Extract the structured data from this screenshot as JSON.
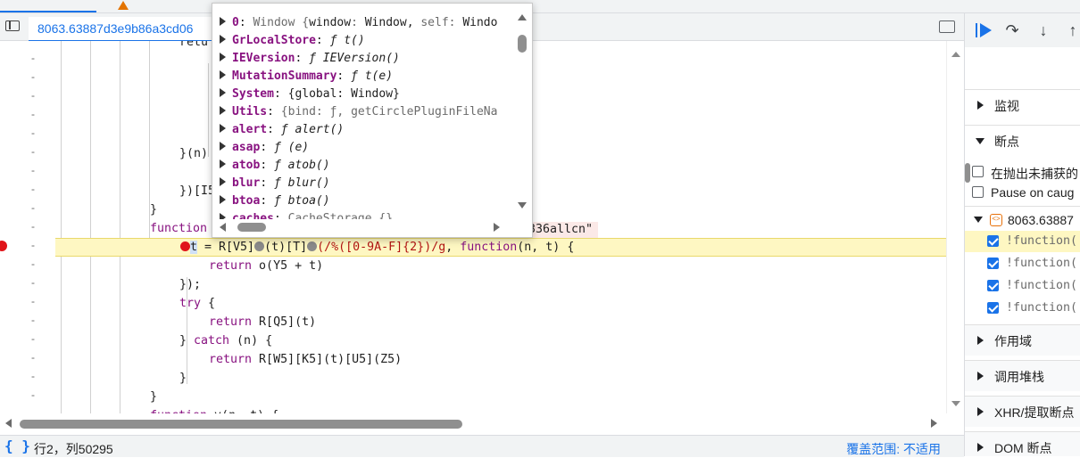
{
  "editor": {
    "file_tab": "8063.63887d3e9b86a3cd06",
    "string_hint": "336allcn\"",
    "lines": [
      {
        "text": "retu"
      },
      {
        "text": "}(n)"
      },
      {
        "text": "})[I5"
      },
      {
        "text": "}"
      },
      {
        "text": "function"
      },
      {
        "text": "return o(Y5 + t)"
      },
      {
        "text": "});"
      },
      {
        "text": "try {"
      },
      {
        "text": "return R[Q5](t)"
      },
      {
        "text": "} catch (n) {"
      },
      {
        "text": "return R[W5][K5](t)[U5](Z5)"
      },
      {
        "text": "}"
      },
      {
        "text": "}"
      },
      {
        "text": "function v(n, t) {"
      }
    ],
    "exec_line": {
      "var": "t",
      "p1": " = R[V5]",
      "p2": "(t)[T]",
      "regex": "(/%([0-9A-F]{2})/g",
      "p3": ", ",
      "kw": "function",
      "p4": "(n, t) {"
    }
  },
  "popover": {
    "rows": [
      {
        "name": "0",
        "value": "Window {window: Window, self: Windo"
      },
      {
        "name": "GrLocalStore",
        "value": "ƒ t()"
      },
      {
        "name": "IEVersion",
        "value": "ƒ IEVersion()"
      },
      {
        "name": "MutationSummary",
        "value": "ƒ t(e)"
      },
      {
        "name": "System",
        "value": "{global: Window}"
      },
      {
        "name": "Utils",
        "value": "{bind: ƒ, getCirclePluginFileNa"
      },
      {
        "name": "alert",
        "value": "ƒ alert()"
      },
      {
        "name": "asap",
        "value": "ƒ (e)"
      },
      {
        "name": "atob",
        "value": "ƒ atob()"
      },
      {
        "name": "blur",
        "value": "ƒ blur()"
      },
      {
        "name": "btoa",
        "value": "ƒ btoa()"
      },
      {
        "name": "caches",
        "value": "CacheStorage {}"
      }
    ]
  },
  "status": {
    "format_icon": "{ }",
    "cursor": "行2，列50295",
    "coverage": "覆盖范围: 不适用"
  },
  "debugger": {
    "sections": {
      "watch": "监视",
      "breakpoints": "断点",
      "scope": "作用域",
      "call_stack": "调用堆栈",
      "xhr": "XHR/提取断点",
      "dom": "DOM 断点"
    },
    "pause_uncaught": "在抛出未捕获的",
    "pause_caught": "Pause on caug",
    "bp_file": "8063.63887",
    "bp_items": [
      "!function(",
      "!function(",
      "!function(",
      "!function("
    ]
  },
  "colors": {
    "accent": "#1a73e8",
    "keyword": "#881280",
    "breakpoint": "#e0141a",
    "exec_highlight": "#fef7c2"
  }
}
